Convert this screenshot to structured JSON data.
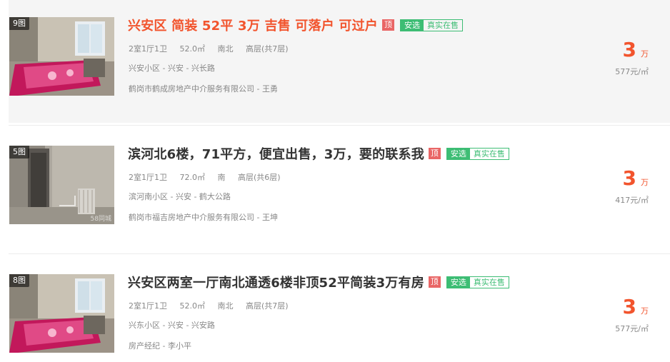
{
  "listings": [
    {
      "photo_count": "9图",
      "title": "兴安区 简装 52平 3万 吉售 可落户 可过户",
      "tag_top": "顶",
      "tag_anxuan": "安选",
      "tag_real": "真实在售",
      "layout": "2室1厅1卫",
      "area": "52.0㎡",
      "orientation": "南北",
      "floor": "高层(共7层)",
      "location": "兴安小区 - 兴安 - 兴长路",
      "agency": "鹤岗市鹤成房地产中介服务有限公司 - 王勇",
      "price": "3",
      "price_unit": "万",
      "unit_price": "577元/㎡"
    },
    {
      "photo_count": "5图",
      "title": "滨河北6楼，71平方，便宜出售，3万，要的联系我",
      "tag_top": "顶",
      "tag_anxuan": "安选",
      "tag_real": "真实在售",
      "layout": "2室1厅1卫",
      "area": "72.0㎡",
      "orientation": "南",
      "floor": "高层(共6层)",
      "location": "滨河南小区 - 兴安 - 鹤大公路",
      "agency": "鹤岗市福吉房地产中介服务有限公司 - 王坤",
      "price": "3",
      "price_unit": "万",
      "unit_price": "417元/㎡",
      "watermark": "58同城"
    },
    {
      "photo_count": "8图",
      "title": "兴安区两室一厅南北通透6楼非顶52平简装3万有房",
      "tag_top": "顶",
      "tag_anxuan": "安选",
      "tag_real": "真实在售",
      "layout": "2室1厅1卫",
      "area": "52.0㎡",
      "orientation": "南北",
      "floor": "高层(共7层)",
      "location": "兴东小区 - 兴安 - 兴安路",
      "agency": "房产经纪 - 李小平",
      "price": "3",
      "price_unit": "万",
      "unit_price": "577元/㎡"
    }
  ]
}
